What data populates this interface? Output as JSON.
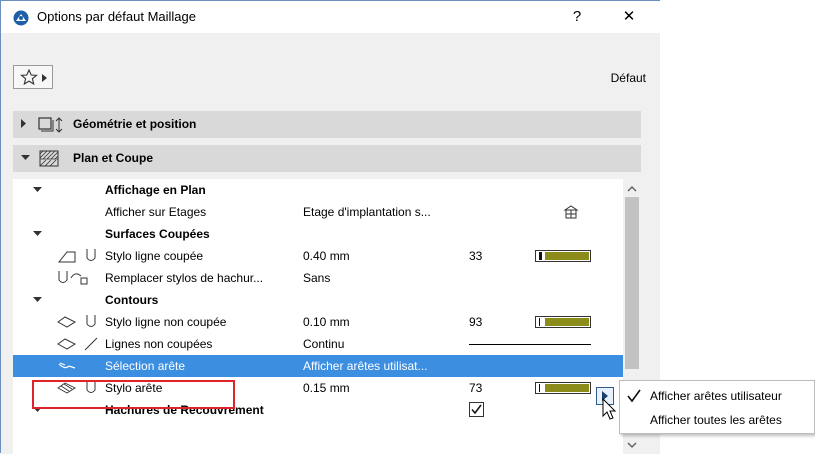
{
  "window": {
    "title": "Options par défaut Maillage",
    "help_label": "?",
    "close_label": "✕"
  },
  "toolbar": {
    "favorites_icon": "star-icon",
    "preset_label": "Défaut"
  },
  "sections": [
    {
      "label": "Géométrie et position",
      "expanded": false
    },
    {
      "label": "Plan et Coupe",
      "expanded": true
    }
  ],
  "table": {
    "groups": {
      "floorplan": "Affichage en Plan",
      "cut": "Surfaces Coupées",
      "outlines": "Contours",
      "cover": "Hachures de Recouvrement"
    },
    "rows": {
      "show_on_stories": {
        "name": "Afficher sur Etages",
        "value": "Etage d'implantation s..."
      },
      "cut_line_pen": {
        "name": "Stylo ligne coupée",
        "value": "0.40 mm",
        "num": "33"
      },
      "override_fill_pens": {
        "name": "Remplacer stylos de hachur...",
        "value": "Sans"
      },
      "uncut_line_pen": {
        "name": "Stylo ligne non coupée",
        "value": "0.10 mm",
        "num": "93"
      },
      "uncut_lines": {
        "name": "Lignes non coupées",
        "value": "Continu"
      },
      "edge_selection": {
        "name": "Sélection arête",
        "value": "Afficher arêtes utilisat..."
      },
      "edge_pen": {
        "name": "Stylo arête",
        "value": "0.15 mm",
        "num": "73"
      }
    }
  },
  "popup_menu": {
    "items": [
      {
        "label": "Afficher arêtes utilisateur",
        "checked": true
      },
      {
        "label": "Afficher toutes les arêtes",
        "checked": false
      }
    ]
  },
  "colors": {
    "selection": "#3c8ee0",
    "pen_swatch": "#8b8c1a",
    "highlight_box": "#e0232b"
  }
}
